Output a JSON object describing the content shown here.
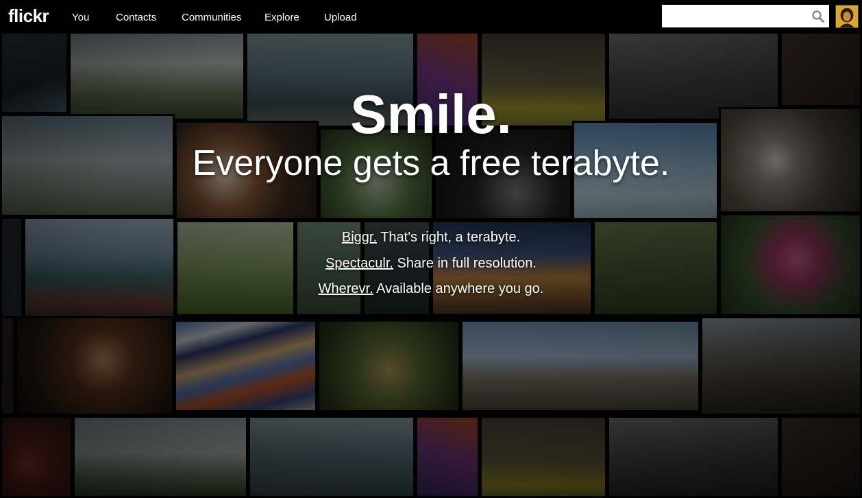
{
  "header": {
    "logo": "flickr",
    "nav": [
      "You",
      "Contacts",
      "Communities",
      "Explore",
      "Upload"
    ],
    "search": {
      "value": "",
      "placeholder": "",
      "icon": "search-icon"
    },
    "avatar_icon": "user-avatar"
  },
  "hero": {
    "title": "Smile.",
    "subtitle": "Everyone gets a free terabyte.",
    "features": [
      {
        "link": "Biggr.",
        "text": " That's right, a terabyte."
      },
      {
        "link": "Spectaculr.",
        "text": " Share in full resolution."
      },
      {
        "link": "Wherevr.",
        "text": " Available anywhere you go."
      }
    ]
  },
  "colors": {
    "header_bg": "#000000",
    "text": "#ffffff"
  }
}
